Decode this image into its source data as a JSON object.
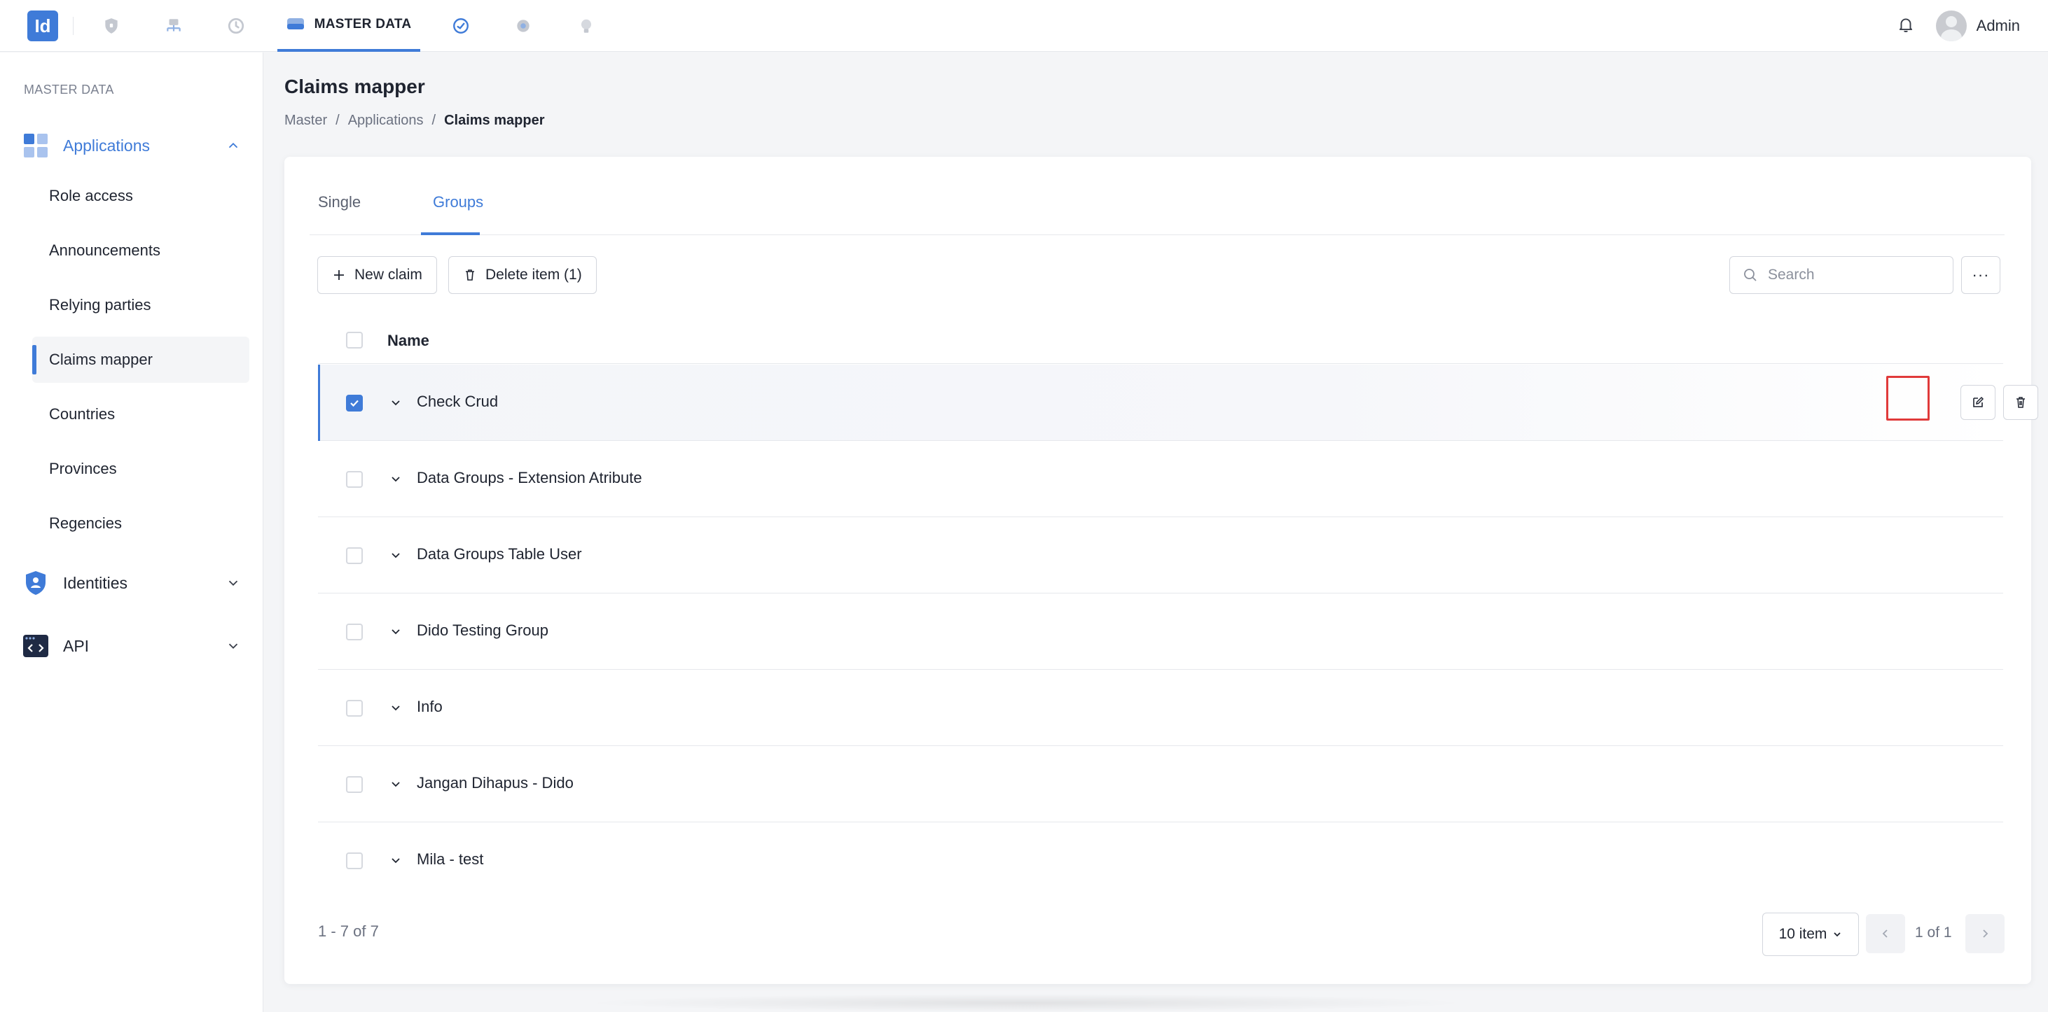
{
  "app": {
    "logo_text": "Id",
    "accent": "#3f7bd8",
    "highlight_color": "#e03a3a"
  },
  "topbar": {
    "icons": [
      "shield-icon",
      "network-icon",
      "history-icon",
      "database-icon",
      "dashboard-icon",
      "settings-icon",
      "bulb-icon"
    ],
    "active_tab": "MASTER DATA",
    "user_name": "Admin"
  },
  "sidebar": {
    "section_label": "MASTER DATA",
    "groups": [
      {
        "label": "Applications",
        "icon": "applications-icon",
        "expanded": true
      },
      {
        "label": "Identities",
        "icon": "identities-icon",
        "expanded": false
      },
      {
        "label": "API",
        "icon": "api-icon",
        "expanded": false
      }
    ],
    "items": [
      "Role access",
      "Announcements",
      "Relying parties",
      "Claims mapper",
      "Countries",
      "Provinces",
      "Regencies"
    ],
    "active_item": "Claims mapper"
  },
  "page": {
    "title": "Claims mapper",
    "breadcrumb": [
      "Master",
      "Applications",
      "Claims mapper"
    ],
    "breadcrumb_separator": "/"
  },
  "tabs": {
    "items": [
      "Single",
      "Groups"
    ],
    "active": "Groups"
  },
  "toolbar": {
    "new_claim_label": "New claim",
    "delete_label": "Delete item (1)",
    "search_placeholder": "Search",
    "more_label": "···"
  },
  "table": {
    "header_name": "Name",
    "rows": [
      {
        "name": "Check Crud",
        "checked": true
      },
      {
        "name": "Data Groups - Extension Atribute",
        "checked": false
      },
      {
        "name": "Data Groups Table User",
        "checked": false
      },
      {
        "name": "Dido Testing Group",
        "checked": false
      },
      {
        "name": "Info",
        "checked": false
      },
      {
        "name": "Jangan Dihapus - Dido",
        "checked": false
      },
      {
        "name": "Mila - test",
        "checked": false
      }
    ]
  },
  "pagination": {
    "count_text": "1 - 7 of 7",
    "page_size_label": "10 item",
    "page_info": "1 of 1"
  }
}
